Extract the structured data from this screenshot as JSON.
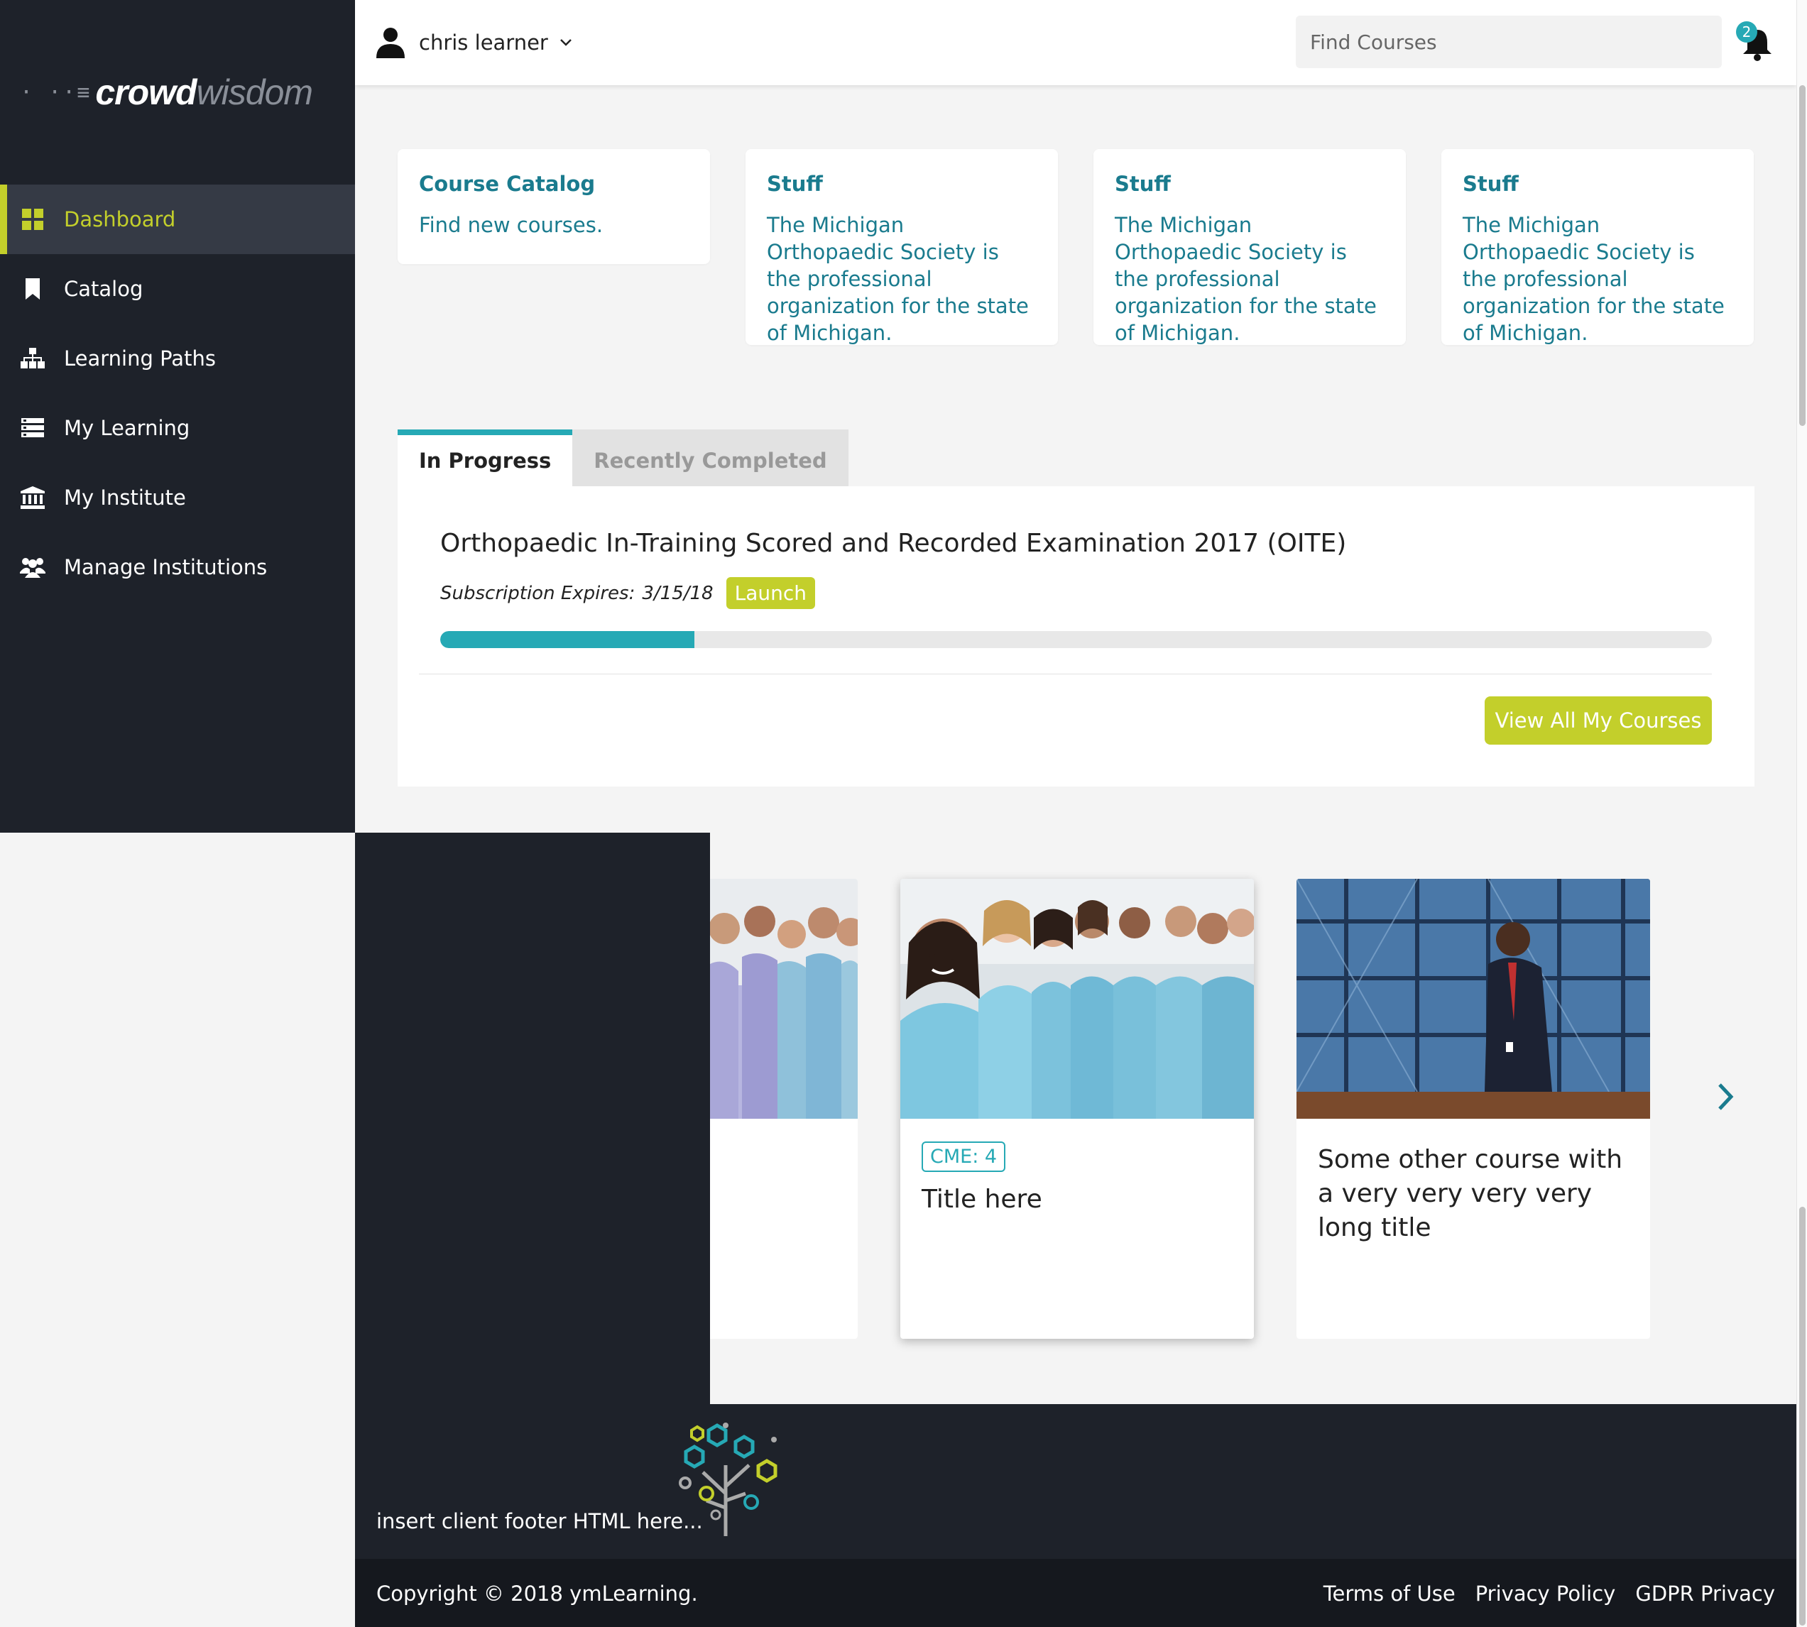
{
  "brand": {
    "logo_dots": "· ··≡",
    "logo_part1": "crowd",
    "logo_part2": "wisdom"
  },
  "sidebar": {
    "items": [
      {
        "label": "Dashboard",
        "icon": "dashboard-grid-icon",
        "active": true
      },
      {
        "label": "Catalog",
        "icon": "bookmark-icon",
        "active": false
      },
      {
        "label": "Learning Paths",
        "icon": "sitemap-icon",
        "active": false
      },
      {
        "label": "My Learning",
        "icon": "list-icon",
        "active": false
      },
      {
        "label": "My Institute",
        "icon": "institution-icon",
        "active": false
      },
      {
        "label": "Manage Institutions",
        "icon": "users-icon",
        "active": false
      }
    ]
  },
  "header": {
    "username": "chris learner",
    "search_placeholder": "Find Courses",
    "notification_count": "2"
  },
  "info_cards": [
    {
      "title": "Course Catalog",
      "text": "Find new courses."
    },
    {
      "title": "Stuff",
      "text": "The Michigan Orthopaedic Society is the professional organization for the state of Michigan."
    },
    {
      "title": "Stuff",
      "text": "The Michigan Orthopaedic Society is the professional organization for the state of Michigan."
    },
    {
      "title": "Stuff",
      "text": "The Michigan Orthopaedic Society is the professional organization for the state of Michigan."
    }
  ],
  "tabs": {
    "in_progress": "In Progress",
    "recently_completed": "Recently Completed"
  },
  "current_course": {
    "title": "Orthopaedic In-Training Scored and Recorded Examination 2017 (OITE)",
    "subscription_label": "Subscription Expires:",
    "subscription_date": "3/15/18",
    "launch_label": "Launch",
    "progress_fraction": 0.2
  },
  "view_all_label": "View All My Courses",
  "carousel": {
    "cards": [
      {
        "cme": "CME: 4",
        "title": "Title here"
      },
      {
        "cme": "",
        "title": "Some other course with a very very very very long title"
      }
    ]
  },
  "footer": {
    "client_html": "insert client footer HTML here...",
    "copyright": "Copyright © 2018 ymLearning.",
    "links": [
      "Terms of Use",
      "Privacy Policy",
      "GDPR Privacy"
    ]
  },
  "colors": {
    "sidebar_bg": "#1e222a",
    "accent_lime": "#c3cf2b",
    "accent_teal": "#26a9b5",
    "link_teal": "#1a7b8e"
  }
}
